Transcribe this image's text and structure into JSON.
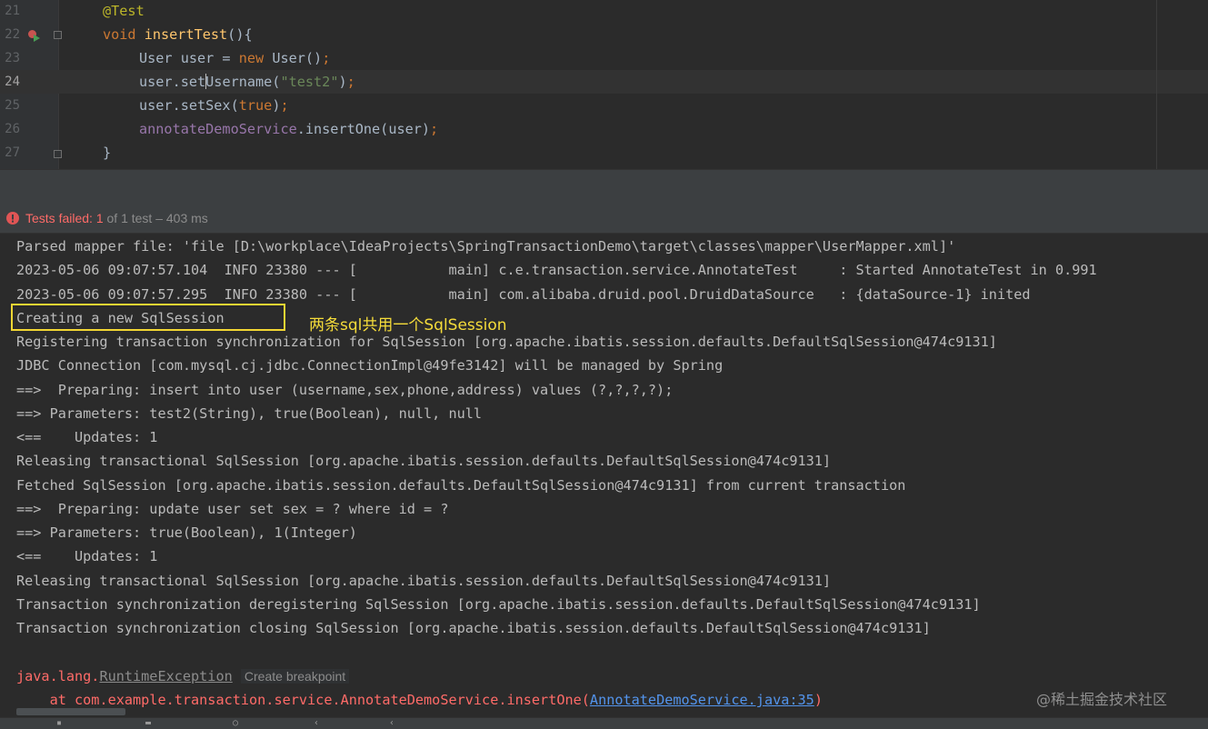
{
  "editor": {
    "line_numbers": [
      "21",
      "22",
      "23",
      "24",
      "25",
      "26",
      "27"
    ],
    "lines": [
      {
        "annotation": "@Test"
      },
      {
        "kw_void": "void",
        "method_name": "insertTest",
        "rest": "(){"
      },
      {
        "prefix": "User user = ",
        "kw_new": "new",
        "suffix": " User()",
        "semi": ";"
      },
      {
        "obj": "user.set",
        "method_after_caret": "Username(",
        "string": "\"test2\"",
        "close": ")",
        "semi": ";"
      },
      {
        "obj": "user.setSex(",
        "kw_true": "true",
        "close": ")",
        "semi": ";"
      },
      {
        "field": "annotateDemoService",
        "rest": ".insertOne(user)",
        "semi": ";"
      },
      {
        "brace": "}"
      }
    ],
    "current_line": "24"
  },
  "test_status": {
    "failed_label": "Tests failed: ",
    "failed_count": "1",
    "rest": " of 1 test – 403 ms"
  },
  "console": {
    "lines": [
      "Parsed mapper file: 'file [D:\\workplace\\IdeaProjects\\SpringTransactionDemo\\target\\classes\\mapper\\UserMapper.xml]'",
      "2023-05-06 09:07:57.104  INFO 23380 --- [           main] c.e.transaction.service.AnnotateTest     : Started AnnotateTest in 0.991",
      "2023-05-06 09:07:57.295  INFO 23380 --- [           main] com.alibaba.druid.pool.DruidDataSource   : {dataSource-1} inited",
      "Creating a new SqlSession",
      "Registering transaction synchronization for SqlSession [org.apache.ibatis.session.defaults.DefaultSqlSession@474c9131]",
      "JDBC Connection [com.mysql.cj.jdbc.ConnectionImpl@49fe3142] will be managed by Spring",
      "==>  Preparing: insert into user (username,sex,phone,address) values (?,?,?,?);",
      "==> Parameters: test2(String), true(Boolean), null, null",
      "<==    Updates: 1",
      "Releasing transactional SqlSession [org.apache.ibatis.session.defaults.DefaultSqlSession@474c9131]",
      "Fetched SqlSession [org.apache.ibatis.session.defaults.DefaultSqlSession@474c9131] from current transaction",
      "==>  Preparing: update user set sex = ? where id = ?",
      "==> Parameters: true(Boolean), 1(Integer)",
      "<==    Updates: 1",
      "Releasing transactional SqlSession [org.apache.ibatis.session.defaults.DefaultSqlSession@474c9131]",
      "Transaction synchronization deregistering SqlSession [org.apache.ibatis.session.defaults.DefaultSqlSession@474c9131]",
      "Transaction synchronization closing SqlSession [org.apache.ibatis.session.defaults.DefaultSqlSession@474c9131]"
    ],
    "exception": {
      "prefix": "java.lang.",
      "class_name": "RuntimeException",
      "hint": "Create breakpoint"
    },
    "stack": {
      "text": "    at com.example.transaction.service.AnnotateDemoService.insertOne(",
      "link": "AnnotateDemoService.java:35",
      "close": ")"
    }
  },
  "annotation_note": "两条sql共用一个SqlSession",
  "watermark": "@稀土掘金技术社区",
  "colors": {
    "background": "#2b2b2b",
    "error": "#ff6b68",
    "link": "#5394ec",
    "highlight": "#f2d633"
  },
  "icons": [
    "run-test-icon",
    "fold-icon",
    "error-icon"
  ]
}
